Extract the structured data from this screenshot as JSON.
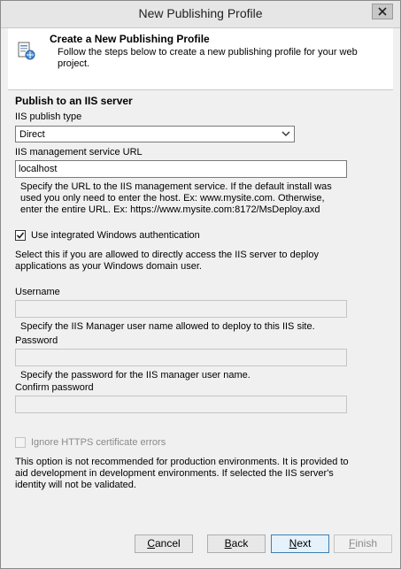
{
  "window": {
    "title": "New Publishing Profile"
  },
  "header": {
    "title": "Create a New Publishing Profile",
    "description": "Follow the steps below to create a new publishing profile for your web project."
  },
  "section": {
    "heading": "Publish to an IIS server"
  },
  "publish_type": {
    "label": "IIS publish type",
    "value": "Direct"
  },
  "service_url": {
    "label": "IIS management service URL",
    "value": "localhost",
    "help": "Specify the URL to the IIS management service. If the default install was used you only need to enter the host. Ex: www.mysite.com. Otherwise, enter the entire URL. Ex: https://www.mysite.com:8172/MsDeploy.axd"
  },
  "windows_auth": {
    "label": "Use integrated Windows authentication",
    "checked": true,
    "help": "Select this if you are allowed to directly access the IIS server to deploy applications as your Windows domain user."
  },
  "username": {
    "label": "Username",
    "value": "",
    "help": "Specify the IIS Manager user name allowed to deploy to this IIS site."
  },
  "password": {
    "label": "Password",
    "value": "",
    "help": "Specify the password for the IIS manager user name."
  },
  "confirm_password": {
    "label": "Confirm password",
    "value": ""
  },
  "ignore_https": {
    "label": "Ignore HTTPS certificate errors",
    "checked": false,
    "help": "This option is not recommended for production environments. It is provided to aid development in development environments. If selected the IIS server's identity will not be validated."
  },
  "buttons": {
    "cancel": {
      "pre": "",
      "accel": "C",
      "post": "ancel"
    },
    "back": {
      "pre": "",
      "accel": "B",
      "post": "ack"
    },
    "next": {
      "pre": "",
      "accel": "N",
      "post": "ext"
    },
    "finish": {
      "pre": "",
      "accel": "F",
      "post": "inish"
    }
  },
  "colors": {
    "primary_border": "#3c7fb1",
    "disabled_text": "#8a8a8a"
  }
}
